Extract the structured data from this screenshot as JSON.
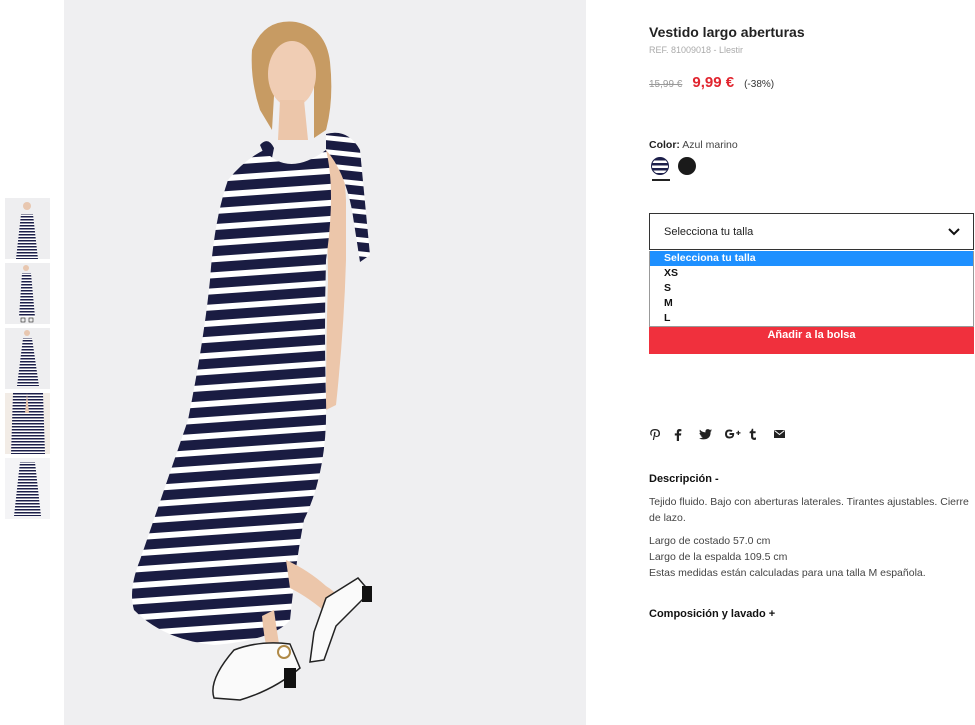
{
  "product": {
    "title": "Vestido largo aberturas",
    "ref": "REF. 81009018 - Llestir",
    "old_price": "15,99 €",
    "new_price": "9,99 €",
    "discount": "(-38%)"
  },
  "color": {
    "label": "Color:",
    "value": "Azul marino",
    "swatches": [
      "navy-white-stripe-swatch",
      "black-swatch"
    ]
  },
  "size": {
    "placeholder": "Selecciona tu talla",
    "options": [
      "Selecciona tu talla",
      "XS",
      "S",
      "M",
      "L"
    ],
    "selected_index": 0
  },
  "actions": {
    "add_to_bag": "Añadir a la bolsa"
  },
  "share_icons": [
    "pinterest-icon",
    "facebook-icon",
    "twitter-icon",
    "google-plus-icon",
    "tumblr-icon",
    "email-icon"
  ],
  "description": {
    "heading": "Descripción -",
    "paragraph1": "Tejido fluido. Bajo con aberturas laterales. Tirantes ajustables. Cierre de lazo.",
    "line1": "Largo de costado 57.0 cm",
    "line2": "Largo de la espalda 109.5 cm",
    "line3": "Estas medidas están calculadas para una talla M española."
  },
  "composition": {
    "heading": "Composición y lavado +"
  },
  "colors": {
    "accent_red": "#e1252f",
    "button_red": "#f0303d",
    "selected_blue": "#1e90ff",
    "navy": "#1c1f4a"
  }
}
